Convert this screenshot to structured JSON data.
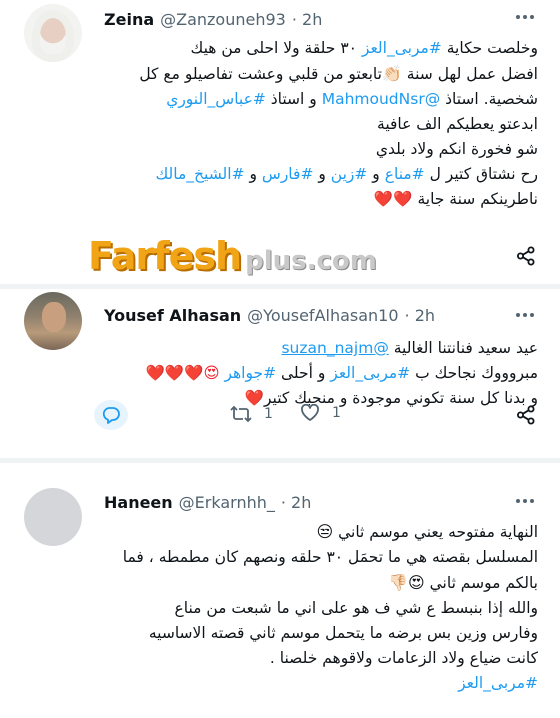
{
  "colors": {
    "link": "#1d9bf0",
    "heart": "#f4212e",
    "muted": "#536471",
    "watermark": "#f2a417"
  },
  "tweets": [
    {
      "name": "Zeina",
      "handle": "@Zanzouneh93",
      "time": "· 2h",
      "lines": [
        [
          "وخلصت حكاية ",
          "#مربى_العز",
          " ٣٠ حلقة ولا احلى من هيك"
        ],
        [
          "افضل عمل لهل سنة ",
          "👏🏻",
          "تابعتو من قلبي وعشت تفاصيلو مع كل"
        ],
        [
          "شخصية. استاذ ",
          "@MahmoudNsr",
          " و استاذ ",
          "#عباس_النوري"
        ],
        [
          "ابدعتو يعطيكم الف عافية"
        ],
        [
          "شو فخورة انكم ولاد بلدي"
        ],
        [
          "رح نشتاق كتير ل ",
          "#مناع",
          " و ",
          "#زين",
          " و ",
          "#فارس",
          " و ",
          "#الشيخ_مالك"
        ],
        [
          "ناطرينكم سنة جاية ",
          "❤️❤️"
        ]
      ]
    },
    {
      "name": "Yousef Alhasan",
      "handle": "@YousefAlhasan10",
      "time": "· 2h",
      "lines": [
        [
          "عيد سعيد فنانتنا الغالية ",
          "@suzan_najm"
        ],
        [
          "مبروووك نجاحك ب ",
          "#مربى_العز",
          " و أحلى ",
          "#جواهر",
          " 😍❤️❤️❤️"
        ],
        [
          "و بدنا كل سنة تكوني موجودة و منحبك كتير",
          "❤️"
        ]
      ],
      "retweets": "1",
      "likes": "1"
    },
    {
      "name": "Haneen",
      "handle": "@Erkarnhh_",
      "time": "· 2h",
      "lines": [
        [
          "النهاية مفتوحه يعني موسم ثاني ",
          "😒"
        ],
        [
          "المسلسل بقصته هي ما تحمَل ٣٠ حلقه ونصهم كان مطمطه ، فما"
        ],
        [
          "بالكم موسم ثاني ",
          "😍👎🏻"
        ],
        [
          "والله إذا بنبسط ع شي ف هو على اني ما شبعت من مناع"
        ],
        [
          "وفارس وزين بس برضه ما يتحمل موسم ثاني قصته الاساسيه"
        ],
        [
          "كانت ضياع ولاد الزعامات ولاقوهم خلصنا ."
        ],
        [
          "#مربى_العز"
        ]
      ]
    }
  ],
  "watermark": {
    "main": "Farfesh",
    "plus": "plus.com"
  },
  "icons": {
    "more": "more-icon",
    "share": "share-icon",
    "reply": "reply-icon",
    "retweet": "retweet-icon",
    "like": "like-icon"
  }
}
